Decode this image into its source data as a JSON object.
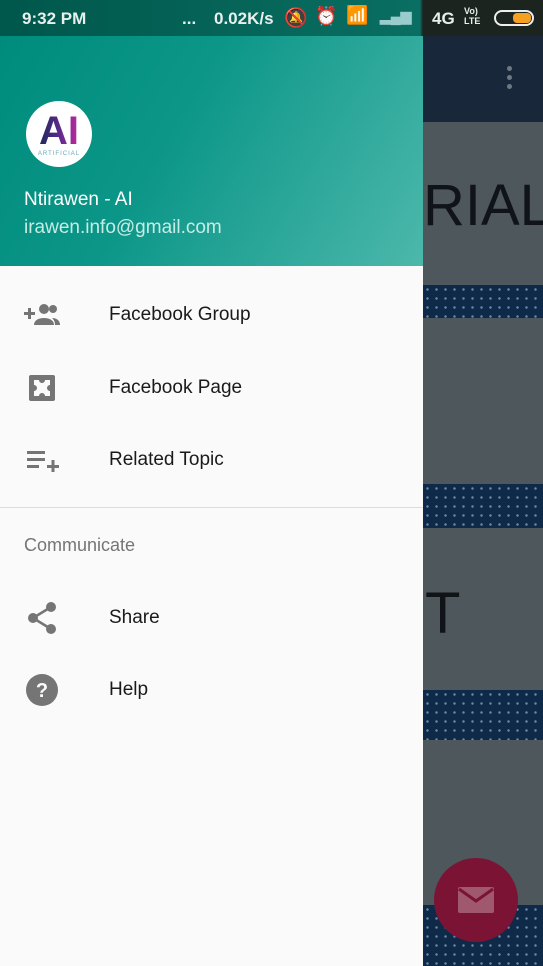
{
  "status_bar": {
    "time": "9:32 PM",
    "dots": "...",
    "speed": "0.02K/s",
    "network": "4G",
    "volte": "Vo) LTE"
  },
  "background": {
    "text1": "RIAL",
    "text2": "T"
  },
  "drawer": {
    "user_name": "Ntirawen - AI",
    "email": "irawen.info@gmail.com",
    "avatar_text": "AI",
    "avatar_caption": "ARTIFICIAL",
    "items": [
      {
        "label": "Facebook Group",
        "icon": "group-add-icon"
      },
      {
        "label": "Facebook Page",
        "icon": "extension-icon"
      },
      {
        "label": "Related Topic",
        "icon": "playlist-add-icon"
      }
    ],
    "section_title": "Communicate",
    "section_items": [
      {
        "label": "Share",
        "icon": "share-icon"
      },
      {
        "label": "Help",
        "icon": "help-icon"
      }
    ]
  },
  "colors": {
    "accent": "#009688",
    "fab": "#c2185b"
  }
}
